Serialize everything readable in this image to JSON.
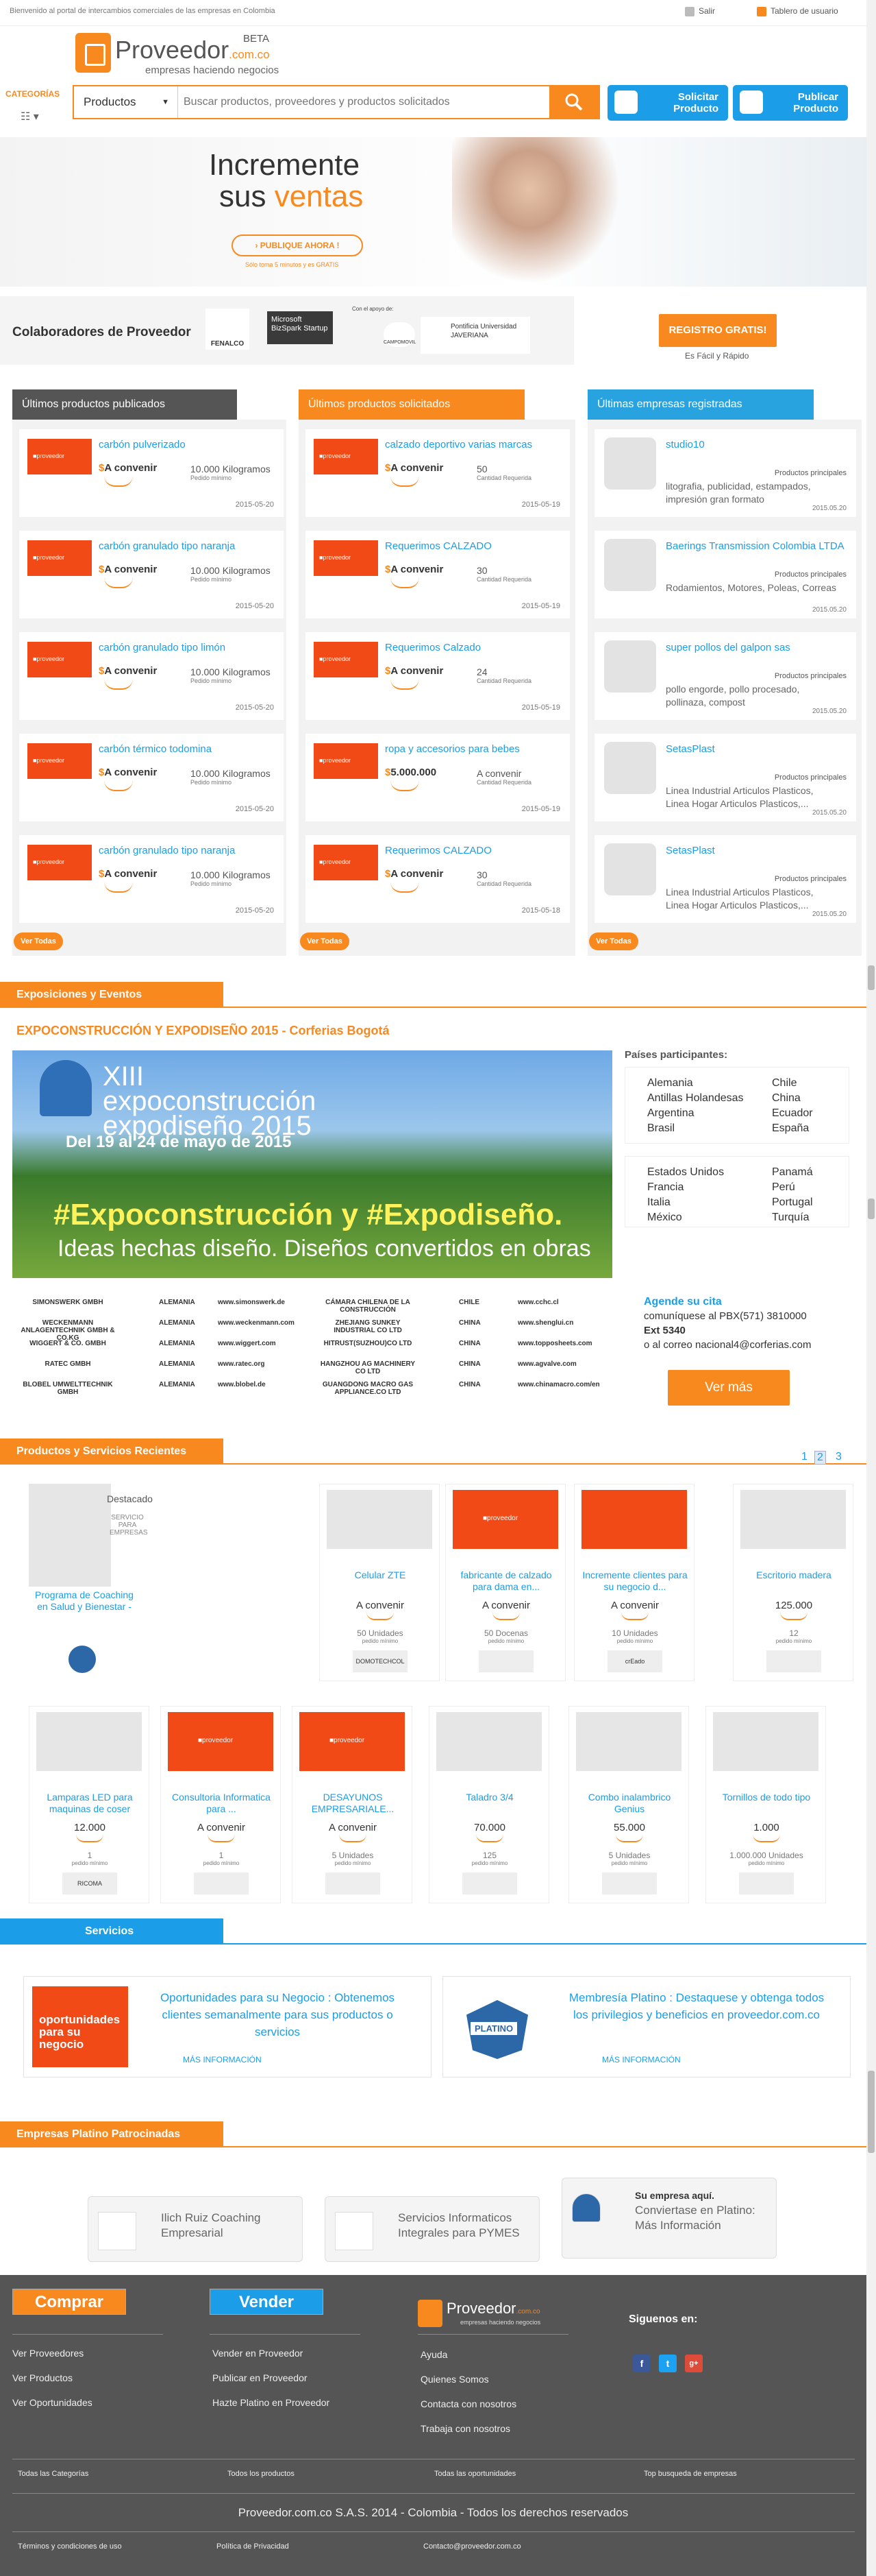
{
  "topbar": {
    "welcome": "Bienvenido al portal de intercambios comerciales de las empresas en Colombia",
    "login": "Salir",
    "board": "Tablero de usuario"
  },
  "header": {
    "logo_text": "Proveedor",
    "logo_domain": ".com.co",
    "beta": "BETA",
    "slogan": "empresas haciendo negocios",
    "categories_label": "CATEGORÍAS"
  },
  "search": {
    "select_value": "Productos",
    "placeholder": "Buscar productos, proveedores y productos solicitados"
  },
  "actions": {
    "request": "Solicitar Producto",
    "publish": "Publicar Producto"
  },
  "banner": {
    "line1": "Incremente",
    "line2a": "sus ",
    "line2b": "ventas",
    "button": "› PUBLIQUE AHORA !",
    "note": "Sólo toma 5 minutos y es GRATIS"
  },
  "collab": {
    "title": "Colaboradores de Proveedor",
    "logos": [
      "FENALCO",
      "Microsoft BizSpark Startup",
      "CAMPOMOVIL",
      "Pontificia Universidad JAVERIANA"
    ],
    "support": "Con el apoyo de:",
    "register": "REGISTRO GRATIS!",
    "register_note": "Es Fácil y Rápido"
  },
  "columns": {
    "published": {
      "title": "Últimos productos publicados",
      "items": [
        {
          "title": "carbón pulverizado",
          "price": "A convenir",
          "qty": "10.000 Kilogramos",
          "qty_label": "Pedido mínimo",
          "date": "2015-05-20"
        },
        {
          "title": "carbón granulado tipo naranja",
          "price": "A convenir",
          "qty": "10.000 Kilogramos",
          "qty_label": "Pedido mínimo",
          "date": "2015-05-20"
        },
        {
          "title": "carbón granulado tipo limón",
          "price": "A convenir",
          "qty": "10.000 Kilogramos",
          "qty_label": "Pedido mínimo",
          "date": "2015-05-20"
        },
        {
          "title": "carbón térmico todomina",
          "price": "A convenir",
          "qty": "10.000 Kilogramos",
          "qty_label": "Pedido mínimo",
          "date": "2015-05-20"
        },
        {
          "title": "carbón granulado tipo naranja",
          "price": "A convenir",
          "qty": "10.000 Kilogramos",
          "qty_label": "Pedido mínimo",
          "date": "2015-05-20"
        }
      ]
    },
    "requested": {
      "title": "Últimos productos solicitados",
      "items": [
        {
          "title": "calzado deportivo varias marcas",
          "price": "A convenir",
          "qty": "50",
          "qty_label": "Cantidad Requerida",
          "date": "2015-05-19"
        },
        {
          "title": "Requerimos CALZADO",
          "price": "A convenir",
          "qty": "30",
          "qty_label": "Cantidad Requerida",
          "date": "2015-05-19"
        },
        {
          "title": "Requerimos Calzado",
          "price": "A convenir",
          "qty": "24",
          "qty_label": "Cantidad Requerida",
          "date": "2015-05-19"
        },
        {
          "title": "ropa y accesorios para bebes",
          "price": "5.000.000",
          "qty": "A convenir",
          "qty_label": "Cantidad Requerida",
          "date": "2015-05-19"
        },
        {
          "title": "Requerimos CALZADO",
          "price": "A convenir",
          "qty": "30",
          "qty_label": "Cantidad Requerida",
          "date": "2015-05-18"
        }
      ]
    },
    "companies": {
      "title": "Últimas empresas registradas",
      "items": [
        {
          "title": "studio10",
          "prod": "Productos principales",
          "desc": "litografia, publicidad, estampados, impresión gran formato",
          "date": "2015.05.20"
        },
        {
          "title": "Baerings Transmission Colombia LTDA",
          "prod": "Productos principales",
          "desc": "Rodamientos, Motores, Poleas, Correas",
          "date": "2015.05.20"
        },
        {
          "title": "super pollos del galpon sas",
          "prod": "Productos principales",
          "desc": "pollo engorde, pollo procesado, pollinaza, compost",
          "date": "2015.05.20"
        },
        {
          "title": "SetasPlast",
          "prod": "Productos principales",
          "desc": "Linea Industrial Articulos Plasticos, Linea Hogar Articulos Plasticos,...",
          "date": "2015.05.20"
        },
        {
          "title": "SetasPlast",
          "prod": "Productos principales",
          "desc": "Linea Industrial Articulos Plasticos, Linea Hogar Articulos Plasticos,...",
          "date": "2015.05.20"
        }
      ]
    },
    "see_all": "Ver Todas"
  },
  "events": {
    "section": "Exposiciones y Eventos",
    "title": "EXPOCONSTRUCCIÓN Y EXPODISEÑO 2015 - Corferias Bogotá",
    "banner": {
      "t1": "XIII expoconstrucción expodiseño 2015",
      "t2": "Del 19 al 24 de mayo de 2015",
      "t3": "#Expoconstrucción y #Expodiseño.",
      "t4": "Ideas hechas diseño. Diseños convertidos en obras"
    },
    "countries_label": "Países participantes:",
    "countries1": [
      "Alemania",
      "Chile",
      "Antillas Holandesas",
      "China",
      "Argentina",
      "Ecuador",
      "Brasil",
      "España"
    ],
    "countries2": [
      "Estados Unidos",
      "Panamá",
      "Francia",
      "Perú",
      "Italia",
      "Portugal",
      "México",
      "Turquía"
    ],
    "exhibitors_left": [
      [
        "SIMONSWERK GMBH",
        "ALEMANIA",
        "www.simonswerk.de"
      ],
      [
        "WECKENMANN ANLAGENTECHNIK GMBH & CO.KG",
        "ALEMANIA",
        "www.weckenmann.com"
      ],
      [
        "WIGGERT & CO. GMBH",
        "ALEMANIA",
        "www.wiggert.com"
      ],
      [
        "RATEC GMBH",
        "ALEMANIA",
        "www.ratec.org"
      ],
      [
        "BLOBEL UMWELTTECHNIK GMBH",
        "ALEMANIA",
        "www.blobel.de"
      ]
    ],
    "exhibitors_right": [
      [
        "CÁMARA CHILENA DE LA CONSTRUCCIÓN",
        "CHILE",
        "www.cchc.cl"
      ],
      [
        "ZHEJIANG SUNKEY INDUSTRIAL CO LTD",
        "CHINA",
        "www.shenglui.cn"
      ],
      [
        "HITRUST(SUZHOU)CO LTD",
        "CHINA",
        "www.topposheets.com"
      ],
      [
        "HANGZHOU AG MACHINERY CO LTD",
        "CHINA",
        "www.agvalve.com"
      ],
      [
        "GUANGDONG MACRO GAS APPLIANCE.CO LTD",
        "CHINA",
        "www.chinamacro.com/en"
      ]
    ],
    "cita": {
      "h": "Agende su cita",
      "l1": "comuníquese al PBX(571) 3810000",
      "l2": "Ext 5340",
      "l3": "o al correo nacional4@corferias.com"
    },
    "more": "Ver más"
  },
  "products": {
    "section": "Productos y Servicios Recientes",
    "pages": [
      "1",
      "2",
      "3"
    ],
    "row1": [
      {
        "name": "Programa de Coaching en Salud y Bienestar -",
        "price": "",
        "units": "",
        "label": "",
        "brand": "",
        "featured": "Destacado",
        "featured_sub": "SERVICIO PARA EMPRESAS"
      },
      {
        "name": "Celular ZTE",
        "price": "A convenir",
        "units": "50 Unidades",
        "label": "pedido mínimo",
        "brand": "DOMOTECHCOL"
      },
      {
        "name": "fabricante de calzado para dama en...",
        "price": "A convenir",
        "units": "50 Docenas",
        "label": "pedido mínimo",
        "brand": ""
      },
      {
        "name": "Incremente clientes para su negocio d...",
        "price": "A convenir",
        "units": "10 Unidades",
        "label": "pedido mínimo",
        "brand": "crEado"
      },
      {
        "name": "Escritorio madera",
        "price": "125.000",
        "units": "12",
        "label": "pedido mínimo",
        "brand": ""
      }
    ],
    "row2": [
      {
        "name": "Lamparas LED para maquinas de coser",
        "price": "12.000",
        "units": "1",
        "label": "pedido mínimo",
        "brand": "RICOMA"
      },
      {
        "name": "Consultoria Informatica para ...",
        "price": "A convenir",
        "units": "1",
        "label": "pedido mínimo",
        "brand": ""
      },
      {
        "name": "DESAYUNOS EMPRESARIALE...",
        "price": "A convenir",
        "units": "5 Unidades",
        "label": "pedido mínimo",
        "brand": ""
      },
      {
        "name": "Taladro 3/4",
        "price": "70.000",
        "units": "125",
        "label": "pedido mínimo",
        "brand": ""
      },
      {
        "name": "Combo inalambrico Genius",
        "price": "55.000",
        "units": "5 Unidades",
        "label": "pedido mínimo",
        "brand": ""
      },
      {
        "name": "Tornillos de todo tipo",
        "price": "1.000",
        "units": "1.000.000 Unidades",
        "label": "pedido mínimo",
        "brand": ""
      }
    ]
  },
  "services": {
    "section": "Servicios",
    "items": [
      {
        "text": "Oportunidades para su Negocio : Obtenemos clientes semanalmente para sus productos o servicios",
        "more": "MÁS INFORMACIÓN",
        "img": "oportunidades para su negocio"
      },
      {
        "text": "Membresía Platino : Destaquese y obtenga todos los privilegios y beneficios en proveedor.com.co",
        "more": "MÁS INFORMACIÓN",
        "img": "PLATINO"
      }
    ]
  },
  "platinum": {
    "section": "Empresas Platino Patrocinadas",
    "items": [
      {
        "name": "Ilich Ruiz Coaching Empresarial"
      },
      {
        "name": "Servicios Informaticos Integrales para PYMES"
      },
      {
        "name_bold": "Su empresa aquí.",
        "name": "Conviertase en Platino: Más Información"
      }
    ]
  },
  "footer": {
    "buy": "Comprar",
    "sell": "Vender",
    "buy_links": [
      "Ver Proveedores",
      "Ver Productos",
      "Ver Oportunidades"
    ],
    "sell_links": [
      "Vender en Proveedor",
      "Publicar en Proveedor",
      "Hazte Platino en Proveedor"
    ],
    "logo": "Proveedor",
    "logo_domain": ".com.co",
    "logo_slogan": "empresas haciendo negocios",
    "info_links": [
      "Ayuda",
      "Quienes Somos",
      "Contacta con nosotros",
      "Trabaja con nosotros"
    ],
    "follow": "Siguenos en:",
    "bottom_links": [
      "Todas las Categorías",
      "Todos los productos",
      "Todas las oportunidades",
      "Top busqueda de empresas"
    ],
    "copyright": "Proveedor.com.co S.A.S. 2014 - Colombia - Todos los derechos reservados",
    "legal": [
      "Términos y condiciones de uso",
      "Política de Privacidad",
      "Contacto@proveedor.com.co"
    ]
  },
  "colors": {
    "orange": "#f7891f",
    "blue": "#1b9ee7",
    "dark": "#444444"
  }
}
